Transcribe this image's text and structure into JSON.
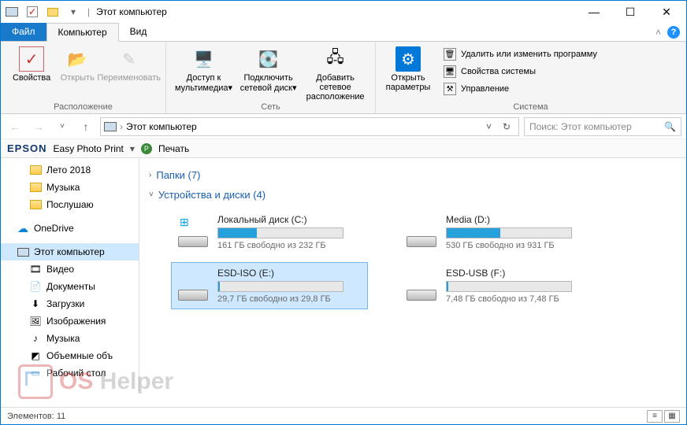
{
  "title": {
    "window": "Этот компьютер"
  },
  "menu": {
    "file": "Файл",
    "computer": "Компьютер",
    "view": "Вид"
  },
  "ribbon": {
    "location_group": "Расположение",
    "network_group": "Сеть",
    "system_group": "Система",
    "properties": "Свойства",
    "open": "Открыть",
    "rename": "Переименовать",
    "media_access": "Доступ к мультимедиа",
    "map_drive": "Подключить сетевой диск",
    "add_net_location": "Добавить сетевое расположение",
    "open_settings": "Открыть параметры",
    "uninstall": "Удалить или изменить программу",
    "sys_properties": "Свойства системы",
    "manage": "Управление"
  },
  "address": {
    "path": "Этот компьютер"
  },
  "search": {
    "placeholder": "Поиск: Этот компьютер"
  },
  "epson": {
    "brand": "EPSON",
    "product": "Easy Photo Print",
    "print": "Печать"
  },
  "tree": {
    "summer": "Лето 2018",
    "music_folder": "Музыка",
    "listen": "Послушаю",
    "onedrive": "OneDrive",
    "thispc": "Этот компьютер",
    "video": "Видео",
    "documents": "Документы",
    "downloads": "Загрузки",
    "images": "Изображения",
    "music": "Музыка",
    "volumes": "Объемные объ",
    "desktop": "Рабочий стол"
  },
  "groups": {
    "folders": "Папки (7)",
    "devices": "Устройства и диски (4)"
  },
  "drives": [
    {
      "name": "Локальный диск (C:)",
      "free": "161 ГБ свободно из 232 ГБ",
      "fill": 31,
      "winlogo": true
    },
    {
      "name": "Media (D:)",
      "free": "530 ГБ свободно из 931 ГБ",
      "fill": 43,
      "winlogo": false
    },
    {
      "name": "ESD-ISO (E:)",
      "free": "29,7 ГБ свободно из 29,8 ГБ",
      "fill": 1,
      "selected": true,
      "winlogo": false
    },
    {
      "name": "ESD-USB (F:)",
      "free": "7,48 ГБ свободно из 7,48 ГБ",
      "fill": 1,
      "winlogo": false
    }
  ],
  "status": {
    "items": "Элементов: 11"
  },
  "watermark": {
    "os": "OS",
    "helper": "Helper"
  }
}
